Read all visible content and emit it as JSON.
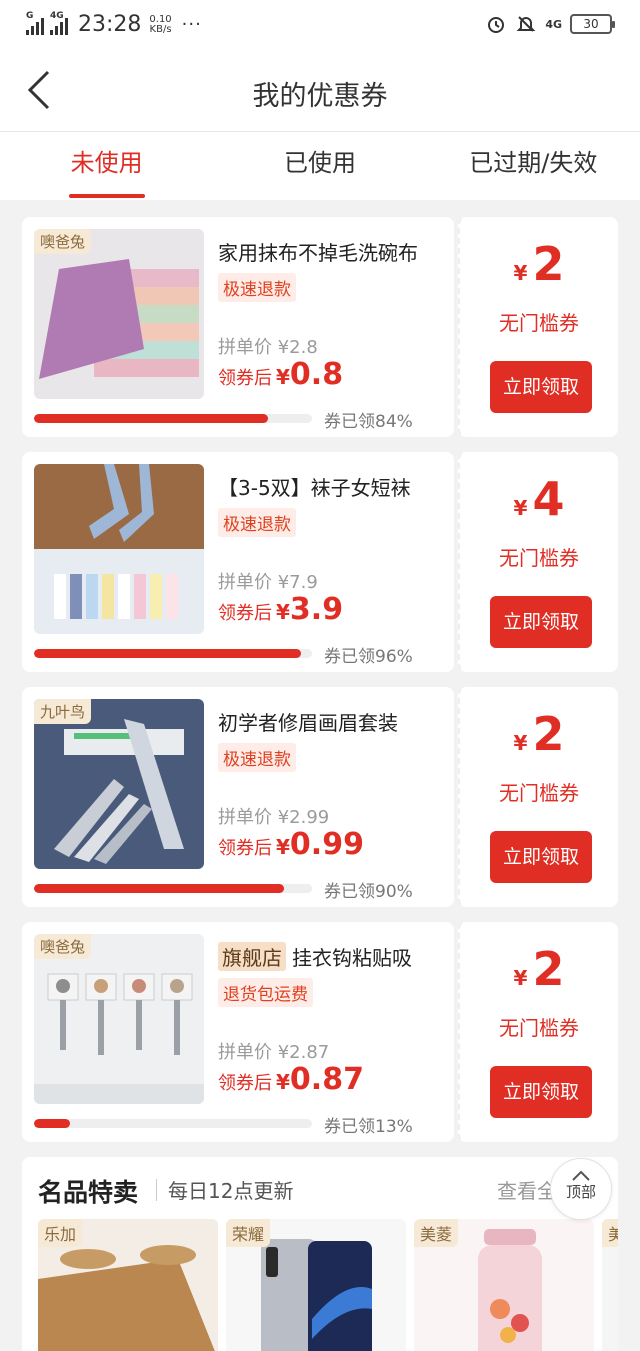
{
  "status_bar": {
    "signal1_label": "G",
    "signal2_label": "4G",
    "time": "23:28",
    "speed_value": "0.10",
    "speed_unit": "KB/s",
    "dots": "···",
    "net_label": "4G",
    "battery": "30"
  },
  "header": {
    "title": "我的优惠券"
  },
  "tabs": [
    {
      "label": "未使用",
      "active": true
    },
    {
      "label": "已使用",
      "active": false
    },
    {
      "label": "已过期/失效",
      "active": false
    }
  ],
  "coupons": [
    {
      "brand": "噢爸兔",
      "flag": "",
      "title": "家用抹布不掉毛洗碗布",
      "tag": "极速退款",
      "group_price_label": "拼单价 ¥2.8",
      "after_label": "领券后",
      "after_yen": "¥",
      "after_price": "0.8",
      "claimed_percent": 84,
      "claimed_text": "券已领84%",
      "coupon_yen": "¥",
      "coupon_amount": "2",
      "coupon_type": "无门槛券",
      "claim_button": "立即领取",
      "image_icon": "towel-image"
    },
    {
      "brand": "",
      "flag": "",
      "title": "【3-5双】袜子女短袜",
      "tag": "极速退款",
      "group_price_label": "拼单价 ¥7.9",
      "after_label": "领券后",
      "after_yen": "¥",
      "after_price": "3.9",
      "claimed_percent": 96,
      "claimed_text": "券已领96%",
      "coupon_yen": "¥",
      "coupon_amount": "4",
      "coupon_type": "无门槛券",
      "claim_button": "立即领取",
      "image_icon": "socks-image"
    },
    {
      "brand": "九叶鸟",
      "flag": "",
      "title": "初学者修眉画眉套装",
      "tag": "极速退款",
      "group_price_label": "拼单价 ¥2.99",
      "after_label": "领券后",
      "after_yen": "¥",
      "after_price": "0.99",
      "claimed_percent": 90,
      "claimed_text": "券已领90%",
      "coupon_yen": "¥",
      "coupon_amount": "2",
      "coupon_type": "无门槛券",
      "claim_button": "立即领取",
      "image_icon": "eyebrow-razor-image"
    },
    {
      "brand": "噢爸兔",
      "flag": "旗舰店",
      "title": "挂衣钩粘贴吸",
      "tag": "退货包运费",
      "group_price_label": "拼单价 ¥2.87",
      "after_label": "领券后",
      "after_yen": "¥",
      "after_price": "0.87",
      "claimed_percent": 13,
      "claimed_text": "券已领13%",
      "coupon_yen": "¥",
      "coupon_amount": "2",
      "coupon_type": "无门槛券",
      "claim_button": "立即领取",
      "image_icon": "hooks-image"
    }
  ],
  "brand_section": {
    "title": "名品特卖",
    "subtitle": "每日12点更新",
    "more": "查看全",
    "items": [
      {
        "brand": "乐加",
        "image_icon": "bamboo-mat-image"
      },
      {
        "brand": "荣耀",
        "image_icon": "phone-image"
      },
      {
        "brand": "美菱",
        "image_icon": "blender-image"
      },
      {
        "brand": "美",
        "image_icon": "product-image"
      }
    ]
  },
  "top_button": {
    "label": "顶部"
  },
  "colors": {
    "accent": "#e02e24",
    "tag_bg": "#f6ead7",
    "bg": "#f2f2f2"
  }
}
